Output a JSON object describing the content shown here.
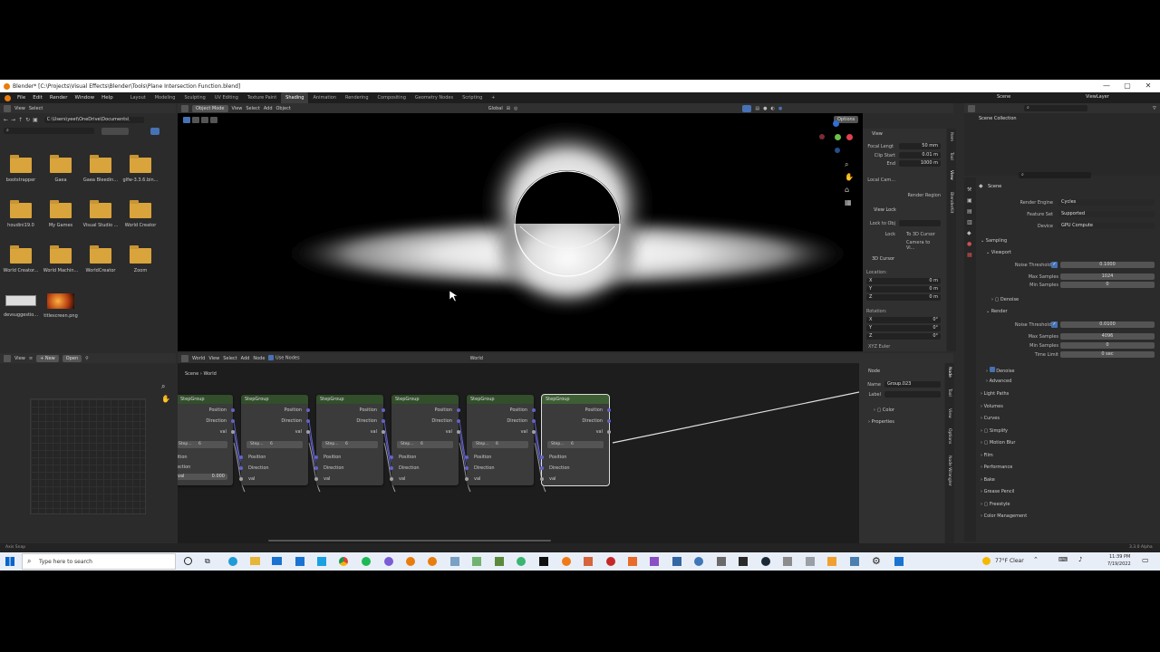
{
  "window": {
    "title": "Blender* [C:\\Projects\\Visual Effects\\Blender\\Tools\\Plane Intersection Function.blend]",
    "minimize": "—",
    "maximize": "▢",
    "close": "✕"
  },
  "menubar": {
    "items": [
      "File",
      "Edit",
      "Render",
      "Window",
      "Help"
    ],
    "workspaces": [
      "Layout",
      "Modeling",
      "Sculpting",
      "UV Editing",
      "Texture Paint",
      "Shading",
      "Animation",
      "Rendering",
      "Compositing",
      "Geometry Nodes",
      "Scripting"
    ],
    "active_workspace": "Shading",
    "scene_label": "Scene",
    "viewlayer_label": "ViewLayer"
  },
  "file_browser": {
    "menu_view": "View",
    "menu_select": "Select",
    "path": "C:\\Users\\yeet\\OneDrive\\Documents\\",
    "items": [
      "bootstrapper",
      "Gaea",
      "Gaea Bleedin...",
      "glfw-3.3.6.bin...",
      "houdini19.0",
      "My Games",
      "Visual Studio ...",
      "World Creator",
      "World Creator...",
      "World Machin...",
      "WorldCreator",
      "Zoom",
      "devsuggestio...",
      "titlescreen.png"
    ]
  },
  "viewport": {
    "mode": "Object Mode",
    "menus": [
      "View",
      "Select",
      "Add",
      "Object"
    ],
    "transform": "Global",
    "options": "Options",
    "sidebar": {
      "view_header": "View",
      "focal_label": "Focal Lengt",
      "focal_value": "50 mm",
      "clip_start_label": "Clip Start",
      "clip_start_value": "0.01 m",
      "end_label": "End",
      "end_value": "1000 m",
      "local_cam": "Local Cam...",
      "render_region": "Render Region",
      "view_lock": "View Lock",
      "lock_to_obj": "Lock to Obj",
      "lock": "Lock",
      "to_3d_cursor": "To 3D Cursor",
      "camera_to_view": "Camera to Vi...",
      "cursor_header": "3D Cursor",
      "location": "Location:",
      "x": "X",
      "y": "Y",
      "z": "Z",
      "loc_x": "0 m",
      "loc_y": "0 m",
      "loc_z": "0 m",
      "rotation": "Rotation:",
      "rot_x": "0°",
      "rot_y": "0°",
      "rot_z": "0°",
      "xyz_euler": "XYZ Euler",
      "tabs": [
        "Item",
        "Tool",
        "View",
        "BlenderKit"
      ]
    }
  },
  "image_editor": {
    "menu_view": "View",
    "new": "New",
    "open": "Open"
  },
  "node_editor": {
    "world": "World",
    "menus": [
      "View",
      "Select",
      "Add",
      "Node"
    ],
    "use_nodes": "Use Nodes",
    "datablock": "World",
    "breadcrumb_scene": "Scene",
    "breadcrumb_world": "World",
    "node_title": "StepGroup",
    "out_position": "Position",
    "out_direction": "Direction",
    "out_val": "val",
    "in_position": "Position",
    "in_direction": "Direction",
    "in_val": "val",
    "step_label": "Step...",
    "step_count": "6",
    "first_val": "0.000",
    "first_partial_position": "sition",
    "first_partial_direction": "rection",
    "sidebar": {
      "node_header": "Node",
      "name_label": "Name",
      "name_value": "Group.023",
      "label_label": "Label",
      "color": "Color",
      "properties": "Properties",
      "tabs": [
        "Node",
        "Tool",
        "View",
        "Options",
        "Node Wrangler"
      ]
    }
  },
  "properties": {
    "scene_collection": "Scene Collection",
    "scene": "Scene",
    "render_engine_label": "Render Engine",
    "render_engine": "Cycles",
    "feature_set_label": "Feature Set",
    "feature_set": "Supported",
    "device_label": "Device",
    "device": "GPU Compute",
    "sampling": "Sampling",
    "viewport": "Viewport",
    "noise_threshold_label": "Noise Threshold",
    "vp_noise_threshold": "0.1000",
    "max_samples_label": "Max Samples",
    "vp_max_samples": "1024",
    "min_samples_label": "Min Samples",
    "vp_min_samples": "0",
    "denoise": "Denoise",
    "render": "Render",
    "r_noise_threshold": "0.0100",
    "r_max_samples": "4096",
    "r_min_samples": "0",
    "time_limit_label": "Time Limit",
    "time_limit": "0 sec",
    "denoise2": "Denoise",
    "advanced": "Advanced",
    "sections": [
      "Light Paths",
      "Volumes",
      "Curves",
      "Simplify",
      "Motion Blur",
      "Film",
      "Performance",
      "Bake",
      "Grease Pencil",
      "Freestyle",
      "Color Management"
    ]
  },
  "statusbar": {
    "left": "Axis Snap",
    "version": "3.3.0 Alpha"
  },
  "taskbar": {
    "search_placeholder": "Type here to search",
    "weather": "77°F  Clear",
    "time": "11:39 PM",
    "date": "7/19/2022"
  },
  "colors": {
    "accent_blue": "#4772b3",
    "node_header": "#324e2b",
    "socket_vector": "#6363c7",
    "socket_float": "#a1a1a1",
    "folder": "#d9a43c"
  }
}
